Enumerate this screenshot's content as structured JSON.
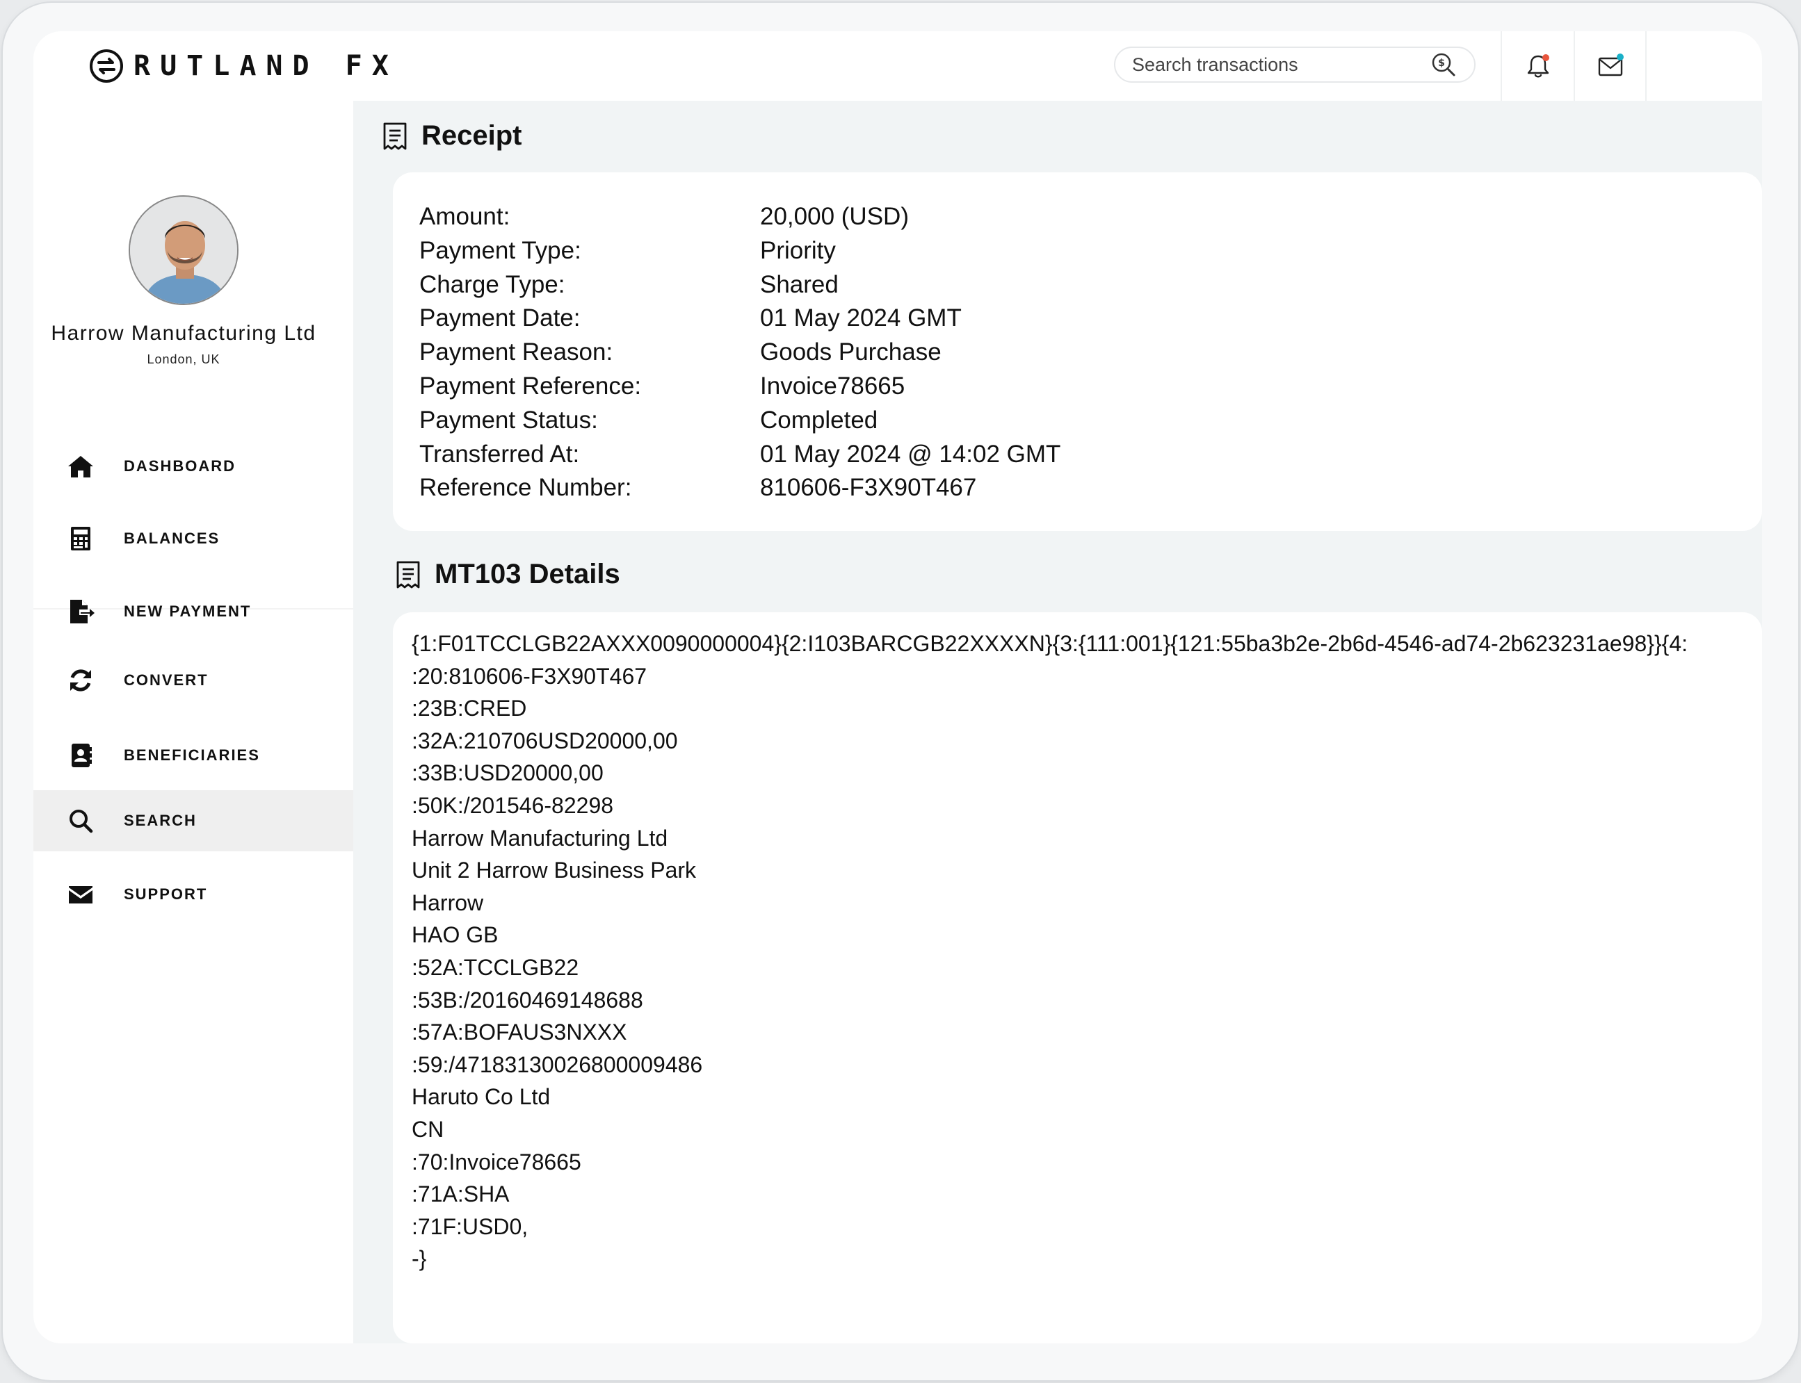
{
  "app": {
    "brand": "RUTLAND FX"
  },
  "header": {
    "search_placeholder": "Search transactions"
  },
  "profile": {
    "company": "Harrow Manufacturing Ltd",
    "location": "London, UK"
  },
  "sidebar": {
    "items": [
      {
        "label": "DASHBOARD",
        "icon": "home-icon"
      },
      {
        "label": "BALANCES",
        "icon": "calculator-icon"
      },
      {
        "label": "NEW PAYMENT",
        "icon": "file-export-icon"
      },
      {
        "label": "CONVERT",
        "icon": "sync-icon"
      },
      {
        "label": "BENEFICIARIES",
        "icon": "address-book-icon"
      },
      {
        "label": "SEARCH",
        "icon": "search-icon",
        "active": true
      },
      {
        "label": "SUPPORT",
        "icon": "envelope-icon"
      }
    ]
  },
  "receipt": {
    "title": "Receipt",
    "rows": [
      {
        "label": "Amount:",
        "value": "20,000 (USD)"
      },
      {
        "label": "Payment Type:",
        "value": "Priority"
      },
      {
        "label": "Charge Type:",
        "value": "Shared"
      },
      {
        "label": "Payment Date:",
        "value": "01 May 2024 GMT"
      },
      {
        "label": "Payment Reason:",
        "value": "Goods Purchase"
      },
      {
        "label": "Payment Reference:",
        "value": "Invoice78665"
      },
      {
        "label": "Payment Status:",
        "value": "Completed"
      },
      {
        "label": "Transferred At:",
        "value": "01 May 2024 @ 14:02 GMT"
      },
      {
        "label": "Reference Number:",
        "value": "810606-F3X90T467"
      }
    ]
  },
  "mt103": {
    "title": "MT103 Details",
    "lines": [
      "{1:F01TCCLGB22AXXX0090000004}{2:I103BARCGB22XXXXN}{3:{111:001}{121:55ba3b2e-2b6d-4546-ad74-2b623231ae98}}{4:",
      ":20:810606-F3X90T467",
      ":23B:CRED",
      ":32A:210706USD20000,00",
      ":33B:USD20000,00",
      ":50K:/201546-82298",
      "Harrow Manufacturing Ltd",
      "Unit 2 Harrow Business Park",
      "Harrow",
      "HAO GB",
      ":52A:TCCLGB22",
      ":53B:/20160469148688",
      ":57A:BOFAUS3NXXX",
      ":59:/47183130026800009486",
      "Haruto Co Ltd",
      "CN",
      ":70:Invoice78665",
      ":71A:SHA",
      ":71F:USD0,",
      "-}"
    ]
  },
  "colors": {
    "notification_dot": "#e8553d",
    "mail_dot": "#1ab0c8",
    "active_nav_bg": "#efefef",
    "page_bg": "#f1f4f5"
  }
}
